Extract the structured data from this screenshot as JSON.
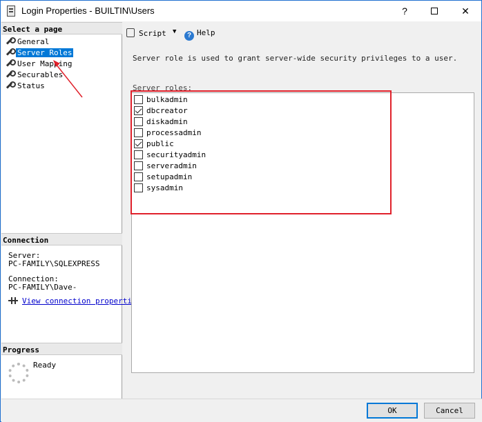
{
  "window": {
    "title": "Login Properties - BUILTIN\\Users",
    "help_glyph": "?",
    "minimize_glyph": "",
    "close_glyph": "✕"
  },
  "left_pane": {
    "select_header": "Select a page",
    "pages": [
      {
        "label": "General",
        "selected": false
      },
      {
        "label": "Server Roles",
        "selected": true
      },
      {
        "label": "User Mapping",
        "selected": false
      },
      {
        "label": "Securables",
        "selected": false
      },
      {
        "label": "Status",
        "selected": false
      }
    ],
    "connection_header": "Connection",
    "server_label": "Server:",
    "server_value": "PC-FAMILY\\SQLEXPRESS",
    "connection_label": "Connection:",
    "connection_value": "PC-FAMILY\\Dave-",
    "view_link": "View connection properti",
    "progress_header": "Progress",
    "progress_status": "Ready"
  },
  "toolbar": {
    "script_label": "Script",
    "dropdown_glyph": "▼",
    "help_label": "Help",
    "help_icon_glyph": "?"
  },
  "main": {
    "description": "Server role is used to grant server-wide security privileges to a user.",
    "roles_label": "Server roles:",
    "roles": [
      {
        "name": "bulkadmin",
        "checked": false
      },
      {
        "name": "dbcreator",
        "checked": true
      },
      {
        "name": "diskadmin",
        "checked": false
      },
      {
        "name": "processadmin",
        "checked": false
      },
      {
        "name": "public",
        "checked": true
      },
      {
        "name": "securityadmin",
        "checked": false
      },
      {
        "name": "serveradmin",
        "checked": false
      },
      {
        "name": "setupadmin",
        "checked": false
      },
      {
        "name": "sysadmin",
        "checked": false
      }
    ]
  },
  "buttons": {
    "ok": "OK",
    "cancel": "Cancel"
  },
  "colors": {
    "selection": "#0078d7",
    "annotation": "#e0202a",
    "link": "#0000cc"
  }
}
